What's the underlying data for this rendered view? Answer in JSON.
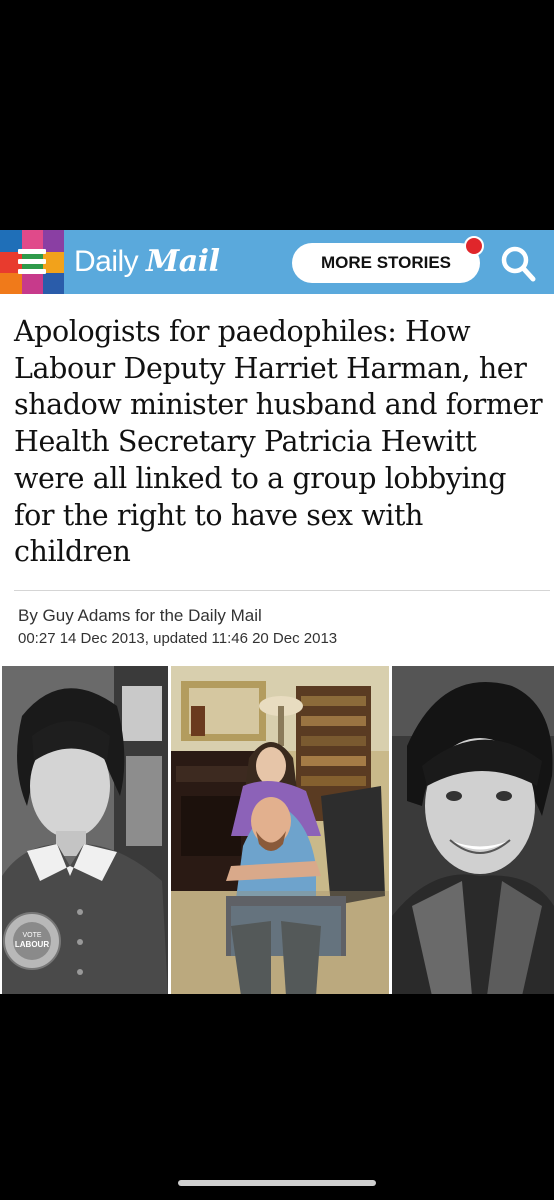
{
  "header": {
    "logo_word1": "Daily",
    "logo_word2": "Mail",
    "more_stories_label": "MORE STORIES",
    "brand_color": "#5aa9dc",
    "notification_color": "#e0262b"
  },
  "article": {
    "headline": "Apologists for paedophiles: How Labour Deputy Harriet Harman, her shadow minister husband and former Health Secretary Patricia Hewitt were all linked to a group lobbying for the right to have sex with children",
    "byline": "By Guy Adams for the Daily Mail",
    "dateline": "00:27 14 Dec 2013, updated 11:46 20 Dec 2013",
    "rosette_text_1": "VOTE",
    "rosette_text_2": "LABOUR"
  },
  "icons": {
    "menu": "hamburger-menu-icon",
    "search": "search-icon"
  }
}
